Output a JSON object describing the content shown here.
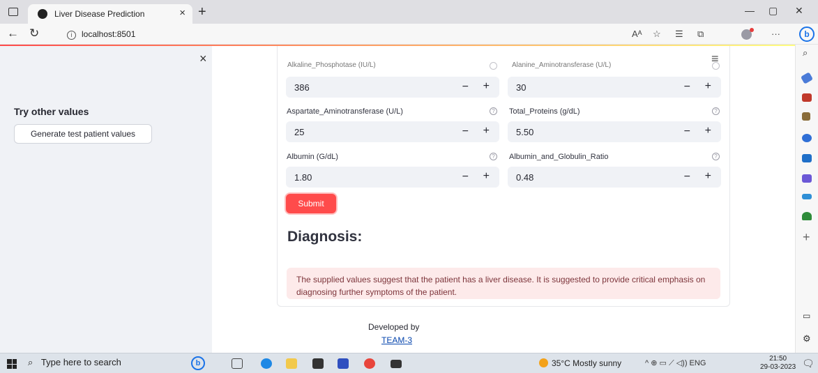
{
  "browser": {
    "tab_title": "Liver Disease Prediction",
    "tab_close": "×",
    "new_tab": "+",
    "url": "localhost:8501",
    "back": "←",
    "reload": "↻",
    "info": "i",
    "read_aloud": "Aᴬ",
    "more": "···",
    "minimize": "—",
    "restore": "▢",
    "close": "✕",
    "copilot": "b"
  },
  "sidebar": {
    "close": "×",
    "heading": "Try other values",
    "button_label": "Generate test patient values"
  },
  "main": {
    "menu": "≡",
    "clipped_left_label": "Alkaline_Phosphotase (IU/L)",
    "clipped_right_label": "Alanine_Aminotransferase (U/L)",
    "fields": [
      {
        "label": "",
        "value": "386"
      },
      {
        "label": "",
        "value": "30"
      },
      {
        "label": "Aspartate_Aminotransferase (U/L)",
        "value": "25"
      },
      {
        "label": "Total_Proteins (g/dL)",
        "value": "5.50"
      },
      {
        "label": "Albumin (G/dL)",
        "value": "1.80"
      },
      {
        "label": "Albumin_and_Globulin_Ratio",
        "value": "0.48"
      }
    ],
    "help_icon": "?",
    "minus": "−",
    "plus": "+",
    "submit_label": "Submit",
    "diagnosis_heading": "Diagnosis:",
    "alert_text": "The supplied values suggest that the patient has a liver disease. It is suggested to provide critical emphasis on diagnosing further symptoms of the patient.",
    "footer_text": "Developed by",
    "footer_link": "TEAM-3"
  },
  "taskbar": {
    "search_placeholder": "Type here to search",
    "search_icon": "⌕",
    "weather": "35°C  Mostly sunny",
    "tray": "^   ⊕  ▭  ⟋  ◁))  ENG",
    "time": "21:50",
    "date": "29-03-2023",
    "notifications": "🗨"
  },
  "colors": {
    "accent": "#ff4b4b",
    "sidebar_bg": "#f0f2f6",
    "alert_bg": "#fdeaea",
    "alert_text": "#7d353b"
  }
}
